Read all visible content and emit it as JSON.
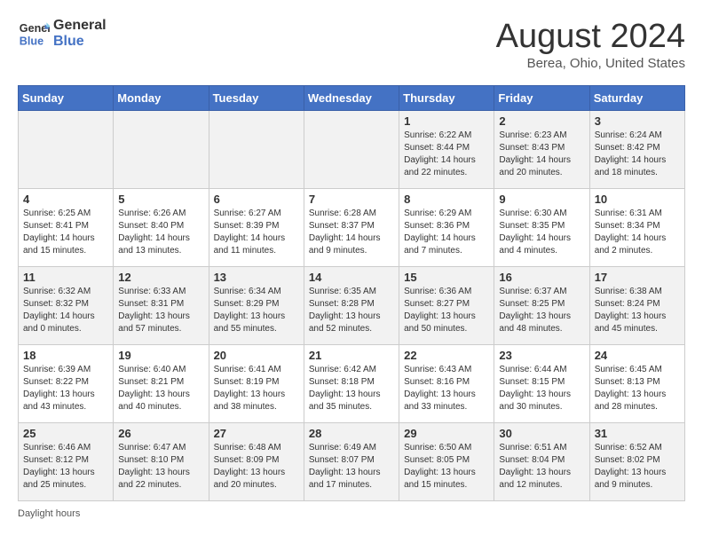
{
  "header": {
    "logo_line1": "General",
    "logo_line2": "Blue",
    "title": "August 2024",
    "subtitle": "Berea, Ohio, United States"
  },
  "days_of_week": [
    "Sunday",
    "Monday",
    "Tuesday",
    "Wednesday",
    "Thursday",
    "Friday",
    "Saturday"
  ],
  "weeks": [
    [
      {
        "day": "",
        "info": ""
      },
      {
        "day": "",
        "info": ""
      },
      {
        "day": "",
        "info": ""
      },
      {
        "day": "",
        "info": ""
      },
      {
        "day": "1",
        "info": "Sunrise: 6:22 AM\nSunset: 8:44 PM\nDaylight: 14 hours\nand 22 minutes."
      },
      {
        "day": "2",
        "info": "Sunrise: 6:23 AM\nSunset: 8:43 PM\nDaylight: 14 hours\nand 20 minutes."
      },
      {
        "day": "3",
        "info": "Sunrise: 6:24 AM\nSunset: 8:42 PM\nDaylight: 14 hours\nand 18 minutes."
      }
    ],
    [
      {
        "day": "4",
        "info": "Sunrise: 6:25 AM\nSunset: 8:41 PM\nDaylight: 14 hours\nand 15 minutes."
      },
      {
        "day": "5",
        "info": "Sunrise: 6:26 AM\nSunset: 8:40 PM\nDaylight: 14 hours\nand 13 minutes."
      },
      {
        "day": "6",
        "info": "Sunrise: 6:27 AM\nSunset: 8:39 PM\nDaylight: 14 hours\nand 11 minutes."
      },
      {
        "day": "7",
        "info": "Sunrise: 6:28 AM\nSunset: 8:37 PM\nDaylight: 14 hours\nand 9 minutes."
      },
      {
        "day": "8",
        "info": "Sunrise: 6:29 AM\nSunset: 8:36 PM\nDaylight: 14 hours\nand 7 minutes."
      },
      {
        "day": "9",
        "info": "Sunrise: 6:30 AM\nSunset: 8:35 PM\nDaylight: 14 hours\nand 4 minutes."
      },
      {
        "day": "10",
        "info": "Sunrise: 6:31 AM\nSunset: 8:34 PM\nDaylight: 14 hours\nand 2 minutes."
      }
    ],
    [
      {
        "day": "11",
        "info": "Sunrise: 6:32 AM\nSunset: 8:32 PM\nDaylight: 14 hours\nand 0 minutes."
      },
      {
        "day": "12",
        "info": "Sunrise: 6:33 AM\nSunset: 8:31 PM\nDaylight: 13 hours\nand 57 minutes."
      },
      {
        "day": "13",
        "info": "Sunrise: 6:34 AM\nSunset: 8:29 PM\nDaylight: 13 hours\nand 55 minutes."
      },
      {
        "day": "14",
        "info": "Sunrise: 6:35 AM\nSunset: 8:28 PM\nDaylight: 13 hours\nand 52 minutes."
      },
      {
        "day": "15",
        "info": "Sunrise: 6:36 AM\nSunset: 8:27 PM\nDaylight: 13 hours\nand 50 minutes."
      },
      {
        "day": "16",
        "info": "Sunrise: 6:37 AM\nSunset: 8:25 PM\nDaylight: 13 hours\nand 48 minutes."
      },
      {
        "day": "17",
        "info": "Sunrise: 6:38 AM\nSunset: 8:24 PM\nDaylight: 13 hours\nand 45 minutes."
      }
    ],
    [
      {
        "day": "18",
        "info": "Sunrise: 6:39 AM\nSunset: 8:22 PM\nDaylight: 13 hours\nand 43 minutes."
      },
      {
        "day": "19",
        "info": "Sunrise: 6:40 AM\nSunset: 8:21 PM\nDaylight: 13 hours\nand 40 minutes."
      },
      {
        "day": "20",
        "info": "Sunrise: 6:41 AM\nSunset: 8:19 PM\nDaylight: 13 hours\nand 38 minutes."
      },
      {
        "day": "21",
        "info": "Sunrise: 6:42 AM\nSunset: 8:18 PM\nDaylight: 13 hours\nand 35 minutes."
      },
      {
        "day": "22",
        "info": "Sunrise: 6:43 AM\nSunset: 8:16 PM\nDaylight: 13 hours\nand 33 minutes."
      },
      {
        "day": "23",
        "info": "Sunrise: 6:44 AM\nSunset: 8:15 PM\nDaylight: 13 hours\nand 30 minutes."
      },
      {
        "day": "24",
        "info": "Sunrise: 6:45 AM\nSunset: 8:13 PM\nDaylight: 13 hours\nand 28 minutes."
      }
    ],
    [
      {
        "day": "25",
        "info": "Sunrise: 6:46 AM\nSunset: 8:12 PM\nDaylight: 13 hours\nand 25 minutes."
      },
      {
        "day": "26",
        "info": "Sunrise: 6:47 AM\nSunset: 8:10 PM\nDaylight: 13 hours\nand 22 minutes."
      },
      {
        "day": "27",
        "info": "Sunrise: 6:48 AM\nSunset: 8:09 PM\nDaylight: 13 hours\nand 20 minutes."
      },
      {
        "day": "28",
        "info": "Sunrise: 6:49 AM\nSunset: 8:07 PM\nDaylight: 13 hours\nand 17 minutes."
      },
      {
        "day": "29",
        "info": "Sunrise: 6:50 AM\nSunset: 8:05 PM\nDaylight: 13 hours\nand 15 minutes."
      },
      {
        "day": "30",
        "info": "Sunrise: 6:51 AM\nSunset: 8:04 PM\nDaylight: 13 hours\nand 12 minutes."
      },
      {
        "day": "31",
        "info": "Sunrise: 6:52 AM\nSunset: 8:02 PM\nDaylight: 13 hours\nand 9 minutes."
      }
    ]
  ],
  "footer": "Daylight hours"
}
